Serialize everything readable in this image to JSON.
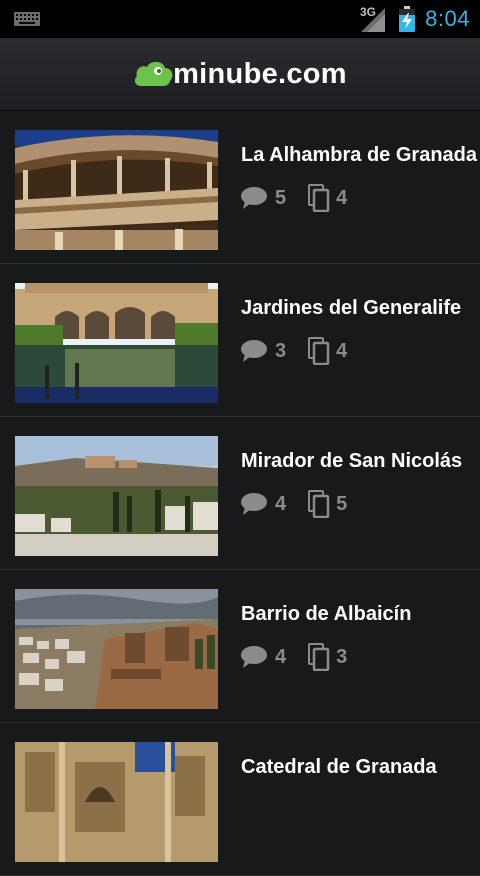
{
  "statusbar": {
    "network": "3G",
    "time": "8:04"
  },
  "header": {
    "logo_text": "minube.com"
  },
  "colors": {
    "accent": "#33b5e5",
    "brand_green": "#6cc24a",
    "background": "#18191b"
  },
  "places": [
    {
      "title": "La Alhambra de Granada",
      "comments": "5",
      "photos": "4"
    },
    {
      "title": "Jardines del Generalife",
      "comments": "3",
      "photos": "4"
    },
    {
      "title": "Mirador de San Nicolás",
      "comments": "4",
      "photos": "5"
    },
    {
      "title": "Barrio de Albaicín",
      "comments": "4",
      "photos": "3"
    },
    {
      "title": "Catedral de Granada",
      "comments": "",
      "photos": ""
    }
  ],
  "icons": {
    "comments": "speech-bubble-icon",
    "photos": "photos-stack-icon"
  }
}
